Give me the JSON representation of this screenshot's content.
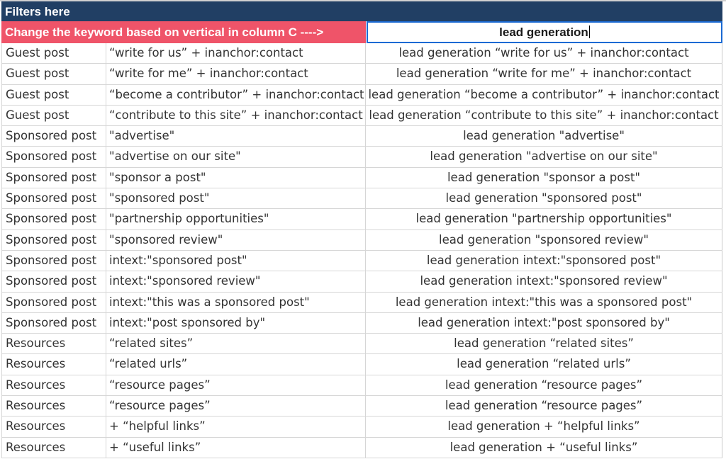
{
  "header": {
    "title": "Filters here"
  },
  "instruction": {
    "text": "Change the keyword based on vertical in column C ---->"
  },
  "keyword_cell": {
    "value": "lead generation"
  },
  "colors": {
    "header_bg": "#213f64",
    "instruction_bg": "#ef5469",
    "selected_border": "#1b6ad3"
  },
  "rows": [
    {
      "type": "Guest post",
      "operator": "“write for us” + inanchor:contact",
      "query": "lead generation “write for us” + inanchor:contact"
    },
    {
      "type": "Guest post",
      "operator": "“write for me” + inanchor:contact",
      "query": "lead generation “write for me” + inanchor:contact"
    },
    {
      "type": "Guest post",
      "operator": "“become a contributor” + inanchor:contact",
      "query": "lead generation “become a contributor” + inanchor:contact"
    },
    {
      "type": "Guest post",
      "operator": "“contribute to this site” + inanchor:contact",
      "query": "lead generation “contribute to this site” + inanchor:contact"
    },
    {
      "type": "Sponsored post",
      "operator": "\"advertise\"",
      "query": "lead generation \"advertise\""
    },
    {
      "type": "Sponsored post",
      "operator": "\"advertise on our site\"",
      "query": "lead generation \"advertise on our site\""
    },
    {
      "type": "Sponsored post",
      "operator": "\"sponsor a post\"",
      "query": "lead generation \"sponsor a post\""
    },
    {
      "type": "Sponsored post",
      "operator": "\"sponsored post\"",
      "query": "lead generation \"sponsored post\""
    },
    {
      "type": "Sponsored post",
      "operator": "\"partnership opportunities\"",
      "query": "lead generation \"partnership opportunities\""
    },
    {
      "type": "Sponsored post",
      "operator": "\"sponsored review\"",
      "query": "lead generation \"sponsored review\""
    },
    {
      "type": "Sponsored post",
      "operator": "intext:\"sponsored post\"",
      "query": "lead generation intext:\"sponsored post\""
    },
    {
      "type": "Sponsored post",
      "operator": "intext:\"sponsored review\"",
      "query": "lead generation intext:\"sponsored review\""
    },
    {
      "type": "Sponsored post",
      "operator": "intext:\"this was a sponsored post\"",
      "query": "lead generation intext:\"this was a sponsored post\""
    },
    {
      "type": "Sponsored post",
      "operator": "intext:\"post sponsored by\"",
      "query": "lead generation intext:\"post sponsored by\""
    },
    {
      "type": "Resources",
      "operator": "“related sites”",
      "query": "lead generation “related sites”"
    },
    {
      "type": "Resources",
      "operator": "“related urls”",
      "query": "lead generation “related urls”"
    },
    {
      "type": "Resources",
      "operator": "“resource pages”",
      "query": "lead generation “resource pages”"
    },
    {
      "type": "Resources",
      "operator": "“resource pages”",
      "query": "lead generation “resource pages”"
    },
    {
      "type": "Resources",
      "operator": "+ “helpful links”",
      "query": "lead generation + “helpful links”"
    },
    {
      "type": "Resources",
      "operator": "+ “useful links”",
      "query": "lead generation + “useful links”"
    }
  ]
}
